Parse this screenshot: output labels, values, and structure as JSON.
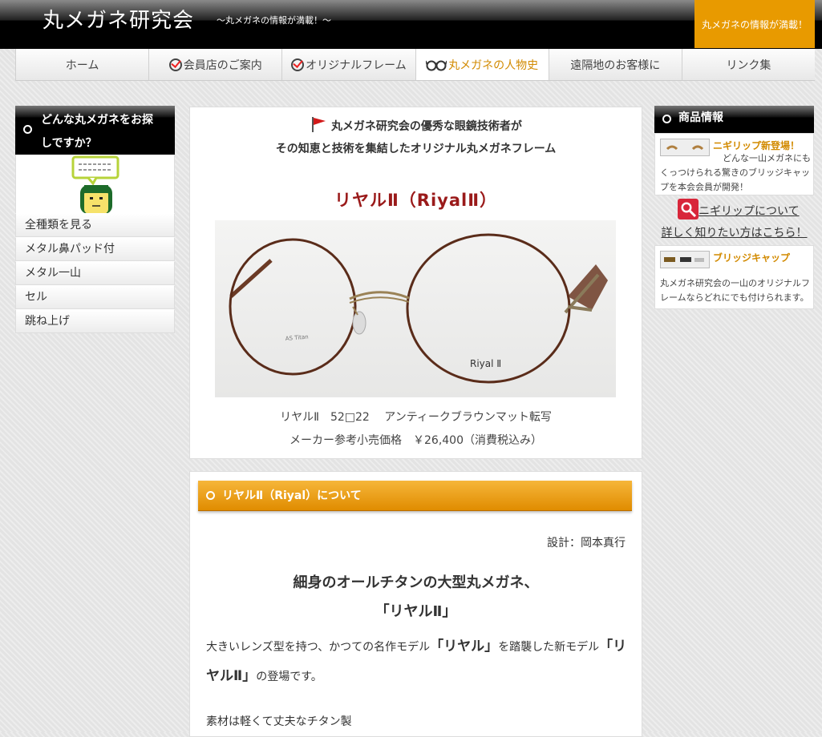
{
  "header": {
    "title": "丸メガネ研究会",
    "tagline": "～丸メガネの情報が満載！～",
    "badge": "丸メガネの情報が満載！"
  },
  "nav": {
    "items": [
      {
        "label": "ホーム",
        "icon": ""
      },
      {
        "label": "会員店のご案内",
        "icon": "check-icon"
      },
      {
        "label": "オリジナルフレーム",
        "icon": "check-icon"
      },
      {
        "label": "丸メガネの人物史",
        "icon": "glasses-icon"
      },
      {
        "label": "遠隔地のお客様に",
        "icon": ""
      },
      {
        "label": "リンク集",
        "icon": ""
      }
    ]
  },
  "left": {
    "heading_line1": "どんな丸メガネをお探",
    "heading_line2": "しですか？",
    "items": [
      "全種類を見る",
      "メタル鼻パッド付",
      "メタル一山",
      "セル",
      "跳ね上げ"
    ]
  },
  "main": {
    "intro_line1": "丸メガネ研究会の優秀な眼鏡技術者が",
    "intro_line2": "その知恵と技術を集結したオリジナル丸メガネフレーム",
    "product_title": "リヤルⅡ（RiyalⅡ）",
    "photo_label": "Riyal Ⅱ",
    "photo_temple_text": "AS Titan",
    "spec_line1": "リヤルⅡ　52□22　 アンティークブラウンマット転写",
    "spec_line2": "メーカー参考小売価格　￥26,400（消費税込み）",
    "section_title": "リヤルⅡ（Riyal）について",
    "designer": "設計：岡本真行",
    "headline_line1": "細身のオールチタンの大型丸メガネ、",
    "headline_line2": "「リヤルⅡ」",
    "para1_a": "大きいレンズ型を持つ、かつての名作モデル",
    "para1_b": "「リヤル」",
    "para1_c": "を踏襲した新モデル",
    "para1_d": "「リヤルⅡ」",
    "para1_e": "の登場です。",
    "para2": "素材は軽くて丈夫なチタン製"
  },
  "right": {
    "heading": "商品情報",
    "item1_title": "ニギリップ新登場！",
    "item1_text": "どんな一山メガネにもくっつけられる驚きのブリッジキャップを本会会員が開発！",
    "link1": "ニギリップについて",
    "link2": "詳しく知りたい方はこちら！",
    "item2_title": "ブリッジキャップ",
    "item2_text": "丸メガネ研究会の一山のオリジナルフレームならどれにでも付けられます。"
  },
  "colors": {
    "accent": "#e89a00",
    "title_red": "#9a1a1a",
    "header_black": "#000000"
  }
}
